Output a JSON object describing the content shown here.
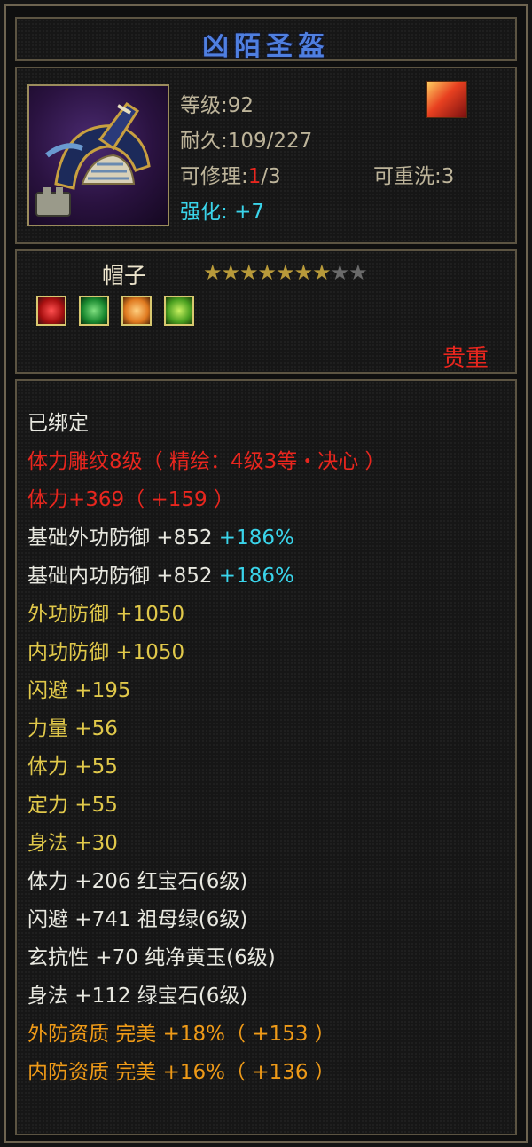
{
  "item": {
    "title": "凶陌圣盔",
    "level": "等级:92",
    "durability": "耐久:109/227",
    "repair_label": "可修理:",
    "repair_used": "1",
    "repair_total": "/3",
    "rewash": "可重洗:3",
    "enhance_label": "强化:",
    "enhance_value": "+7",
    "slot": "帽子",
    "stars_on": "★★★★★★★",
    "stars_off": "★★",
    "rarity": "贵重"
  },
  "gems": [
    "red-gem-icon",
    "green-gem-icon",
    "orange-gem-icon",
    "lime-gem-icon"
  ],
  "colors": {
    "title": "#4f7fe0",
    "white": "#e8e8e0",
    "red": "#e8261e",
    "gold": "#e0c84a",
    "cyan": "#3ad4ea",
    "orange": "#ee9a18"
  },
  "stats": {
    "bound": "已绑定",
    "engrave": "体力雕纹8级（ 精绘：4级3等・决心 ）",
    "vit_bonus": "体力+369（ +159 ）",
    "base_ext_def": "基础外功防御  +852",
    "base_ext_def_pct": "+186%",
    "base_int_def": "基础内功防御  +852",
    "base_int_def_pct": "+186%",
    "ext_def": "外功防御  +1050",
    "int_def": "内功防御  +1050",
    "dodge": "闪避  +195",
    "strength": "力量  +56",
    "vitality": "体力  +55",
    "focus": "定力  +55",
    "agility": "身法  +30",
    "gem_vit": "体力  +206  红宝石(6级)",
    "gem_dodge": "闪避  +741  祖母绿(6级)",
    "gem_res": "玄抗性  +70  纯净黄玉(6级)",
    "gem_agi": "身法  +112  绿宝石(6级)",
    "ext_quality": "外防资质    完美  +18%（ +153 ）",
    "int_quality": "内防资质    完美  +16%（ +136 ）"
  }
}
